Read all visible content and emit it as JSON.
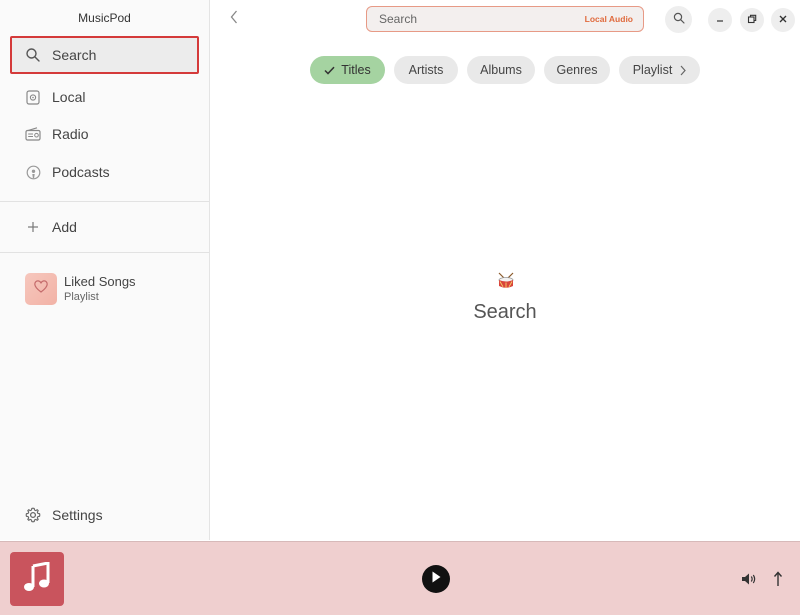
{
  "app": {
    "title": "MusicPod"
  },
  "sidebar": {
    "items": [
      {
        "label": "Search",
        "icon": "search-icon"
      },
      {
        "label": "Local",
        "icon": "local-disk-icon"
      },
      {
        "label": "Radio",
        "icon": "radio-icon"
      },
      {
        "label": "Podcasts",
        "icon": "podcast-icon"
      }
    ],
    "add": {
      "label": "Add",
      "icon": "plus-icon"
    },
    "playlists": [
      {
        "title": "Liked Songs",
        "subtitle": "Playlist",
        "icon": "heart-icon"
      }
    ],
    "settings": {
      "label": "Settings",
      "icon": "gear-icon"
    }
  },
  "topbar": {
    "search_placeholder": "Search",
    "search_scope": "Local Audio"
  },
  "filters": [
    {
      "label": "Titles",
      "active": true
    },
    {
      "label": "Artists",
      "active": false
    },
    {
      "label": "Albums",
      "active": false
    },
    {
      "label": "Genres",
      "active": false
    },
    {
      "label": "Playlist",
      "active": false
    }
  ],
  "main": {
    "empty_title": "Search",
    "empty_icon": "drum-emoji-icon"
  },
  "colors": {
    "accent": "#e06a3d",
    "chip_active": "#a5d3a1",
    "player_bg": "#efcfcf",
    "cover_bg": "#c9545d",
    "selection_border": "#d43a3a"
  }
}
